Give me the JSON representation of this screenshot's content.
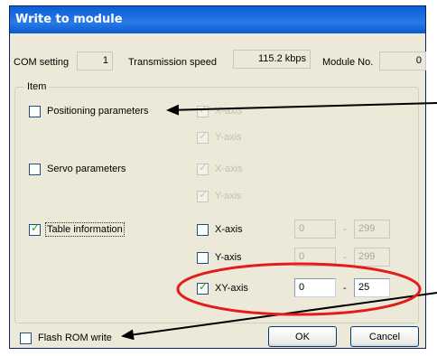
{
  "window": {
    "title": "Write to module"
  },
  "header": {
    "com_label": "COM setting",
    "com_value": "1",
    "speed_label": "Transmission speed",
    "speed_value": "115.2 kbps",
    "module_label": "Module No.",
    "module_value": "0"
  },
  "item_group": {
    "legend": "Item",
    "positioning": {
      "label": "Positioning parameters",
      "checked": false,
      "x_axis": "X-axis",
      "y_axis": "Y-axis"
    },
    "servo": {
      "label": "Servo parameters",
      "checked": false,
      "x_axis": "X-axis",
      "y_axis": "Y-axis"
    },
    "table": {
      "label": "Table information",
      "checked": true,
      "rows": [
        {
          "axis": "X-axis",
          "checked": false,
          "from": "0",
          "to": "299"
        },
        {
          "axis": "Y-axis",
          "checked": false,
          "from": "0",
          "to": "299"
        },
        {
          "axis": "XY-axis",
          "checked": true,
          "from": "0",
          "to": "25"
        }
      ],
      "separator": "-"
    }
  },
  "footer": {
    "flash_label": "Flash ROM write",
    "ok_label": "OK",
    "cancel_label": "Cancel"
  },
  "tick_glyph": "✓",
  "colors": {
    "annotation_ellipse": "#e41b1b",
    "arrow": "#000000",
    "title_bar": "#0a5fd8"
  }
}
